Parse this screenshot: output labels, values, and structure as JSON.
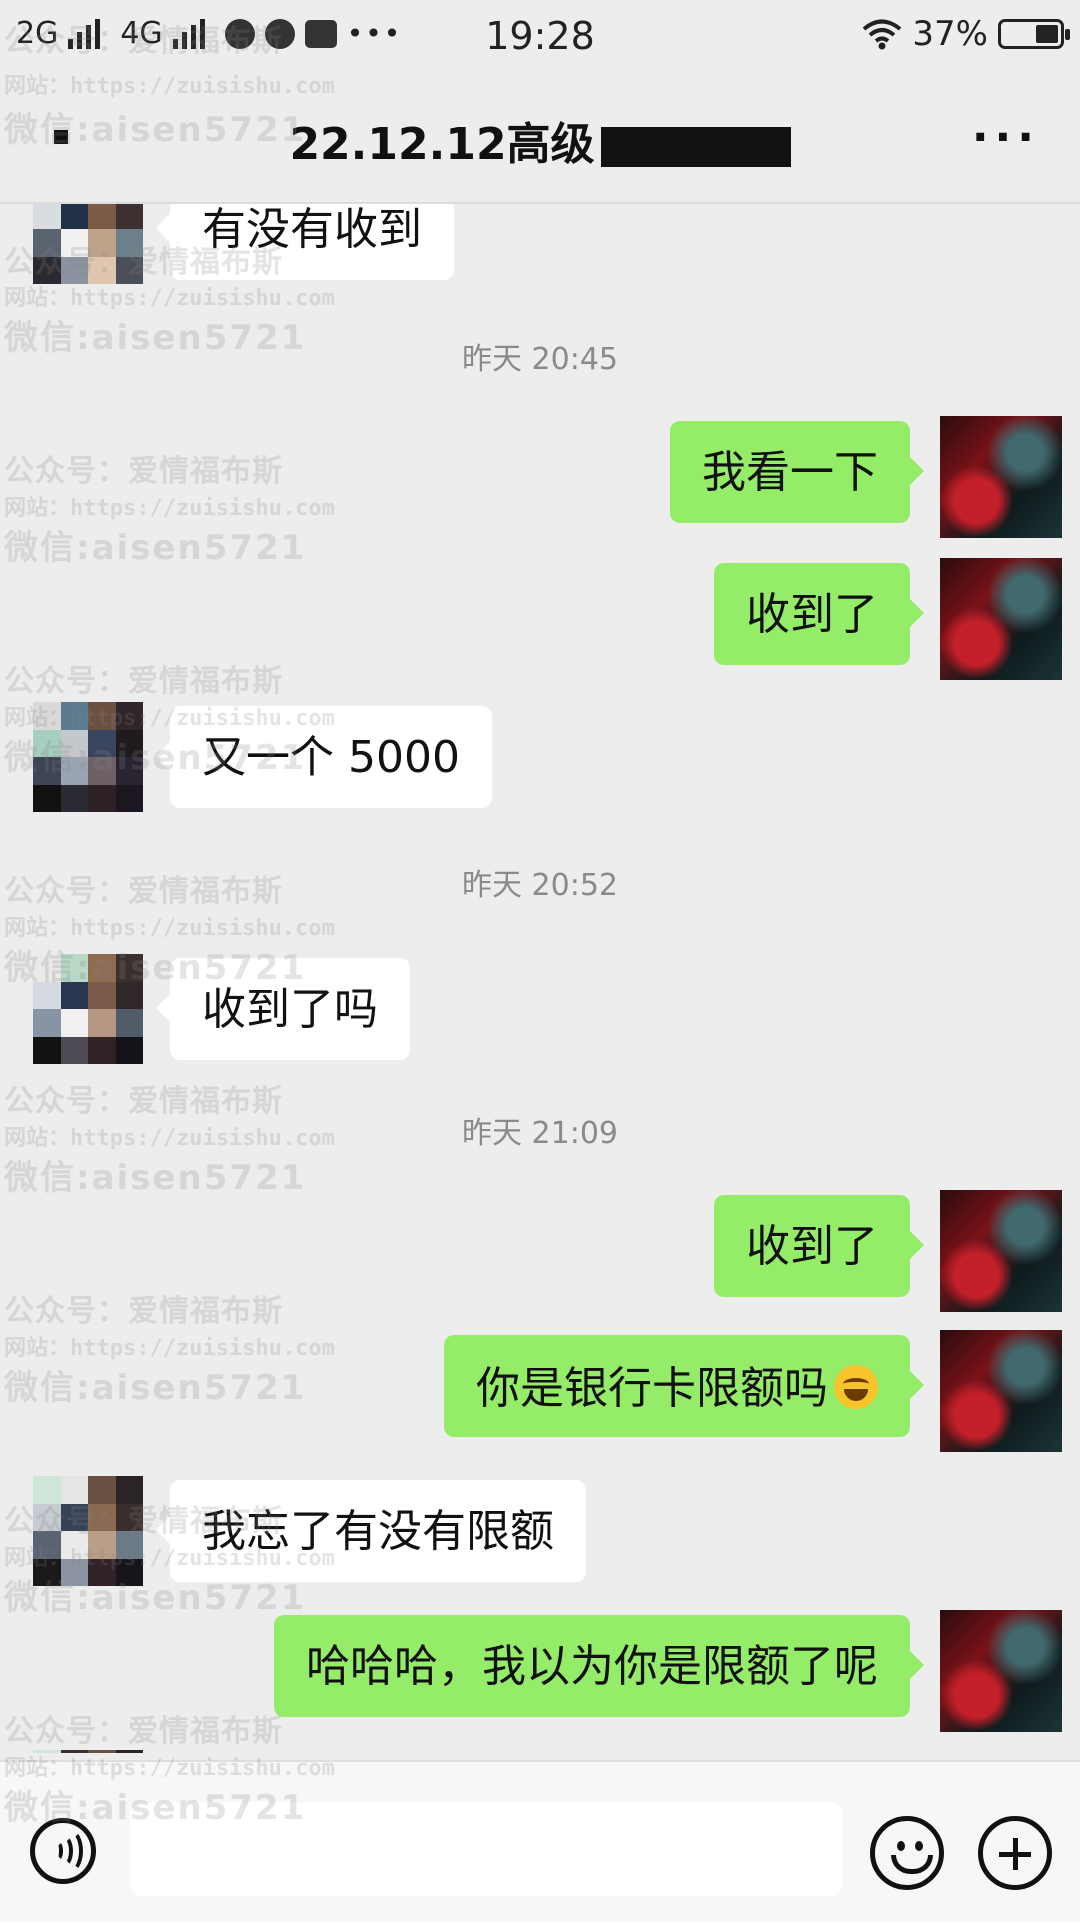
{
  "status_bar": {
    "network1": "2G",
    "network2": "4G",
    "time": "19:28",
    "battery": "37%"
  },
  "header": {
    "title": "22.12.12高级"
  },
  "messages": [
    {
      "kind": "text",
      "side": "left",
      "text": "有没有收到"
    },
    {
      "kind": "time",
      "text": "昨天 20:45"
    },
    {
      "kind": "text",
      "side": "right",
      "text": "我看一下"
    },
    {
      "kind": "text",
      "side": "right",
      "text": "收到了"
    },
    {
      "kind": "text",
      "side": "left",
      "text": "又一个 5000"
    },
    {
      "kind": "time",
      "text": "昨天 20:52"
    },
    {
      "kind": "text",
      "side": "left",
      "text": "收到了吗"
    },
    {
      "kind": "time",
      "text": "昨天 21:09"
    },
    {
      "kind": "text",
      "side": "right",
      "text": "收到了"
    },
    {
      "kind": "text",
      "side": "right",
      "text": "你是银行卡限额吗",
      "emoji": "tears-of-joy"
    },
    {
      "kind": "text",
      "side": "left",
      "text": "我忘了有没有限额"
    },
    {
      "kind": "text",
      "side": "right",
      "text": "哈哈哈，我以为你是限额了呢"
    }
  ],
  "watermark": {
    "line1": "公众号：爱情福布斯",
    "line2": "网站：https://zuisishu.com",
    "line3": "微信:aisen5721"
  },
  "input": {
    "value": "",
    "placeholder": ""
  },
  "icons": {
    "voice": "voice-icon",
    "emoji": "emoji-icon",
    "plus": "plus-icon",
    "back": "back-icon",
    "more": "more-icon"
  },
  "colors": {
    "background": "#ededed",
    "sent_bubble": "#95ec69",
    "received_bubble": "#ffffff",
    "timestamp": "#8a8a8a"
  }
}
